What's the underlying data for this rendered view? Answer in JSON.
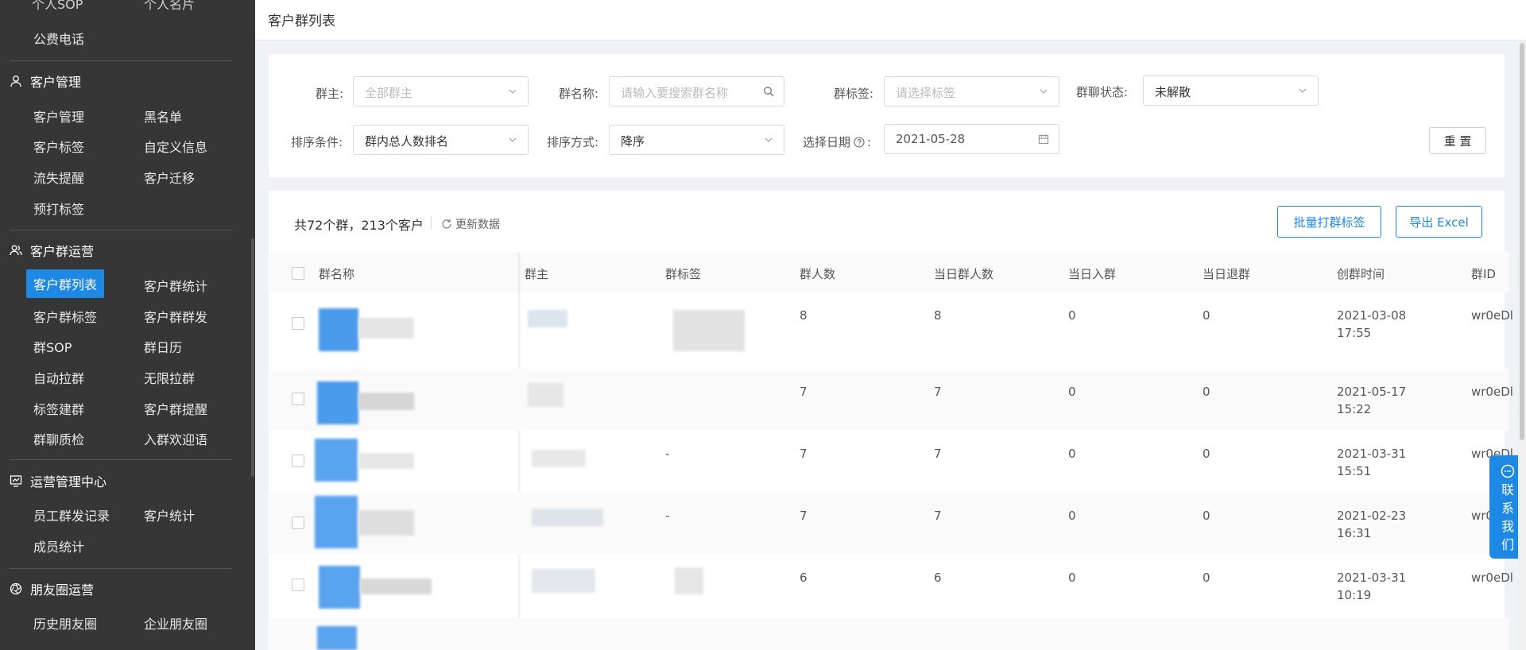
{
  "sidebar": {
    "clipped_top": [
      "个人SOP",
      "个人名片"
    ],
    "top_item": "公费电话",
    "sections": [
      {
        "title": "客户管理",
        "items": [
          "客户管理",
          "黑名单",
          "客户标签",
          "自定义信息",
          "流失提醒",
          "客户迁移",
          "预打标签"
        ]
      },
      {
        "title": "客户群运营",
        "items": [
          "客户群列表",
          "客户群统计",
          "客户群标签",
          "客户群群发",
          "群SOP",
          "群日历",
          "自动拉群",
          "无限拉群",
          "标签建群",
          "客户群提醒",
          "群聊质检",
          "入群欢迎语"
        ]
      },
      {
        "title": "运营管理中心",
        "items": [
          "员工群发记录",
          "客户统计",
          "成员统计"
        ]
      },
      {
        "title": "朋友圈运营",
        "items": [
          "历史朋友圈",
          "企业朋友圈"
        ]
      }
    ],
    "active_item": "客户群列表"
  },
  "header": {
    "title": "客户群列表"
  },
  "filters": {
    "owner": {
      "label": "群主:",
      "placeholder": "全部群主"
    },
    "name": {
      "label": "群名称:",
      "placeholder": "请输入要搜索群名称"
    },
    "tag": {
      "label": "群标签:",
      "placeholder": "请选择标签"
    },
    "status": {
      "label": "群聊状态:",
      "value": "未解散"
    },
    "sort_cond": {
      "label": "排序条件:",
      "value": "群内总人数排名"
    },
    "sort_order": {
      "label": "排序方式:",
      "value": "降序"
    },
    "date": {
      "label": "选择日期",
      "colon": ":",
      "value": "2021-05-28"
    },
    "reset_label": "重 置"
  },
  "summary": {
    "text": "共72个群，213个客户",
    "refresh_label": "更新数据"
  },
  "actions": {
    "bulk_tag": "批量打群标签",
    "export": "导出 Excel"
  },
  "table": {
    "columns": [
      "群名称",
      "群主",
      "群标签",
      "群人数",
      "当日群人数",
      "当日入群",
      "当日退群",
      "创群时间",
      "群ID"
    ],
    "rows": [
      {
        "tags": "",
        "members": "8",
        "today_members": "8",
        "joined": "0",
        "left": "0",
        "date": "2021-03-08",
        "time": "17:55",
        "id": "wr0eDl"
      },
      {
        "tags": "",
        "members": "7",
        "today_members": "7",
        "joined": "0",
        "left": "0",
        "date": "2021-05-17",
        "time": "15:22",
        "id": "wr0eDl"
      },
      {
        "tags": "-",
        "members": "7",
        "today_members": "7",
        "joined": "0",
        "left": "0",
        "date": "2021-03-31",
        "time": "15:51",
        "id": "wr0eDl"
      },
      {
        "tags": "-",
        "members": "7",
        "today_members": "7",
        "joined": "0",
        "left": "0",
        "date": "2021-02-23",
        "time": "16:31",
        "id": "wr0"
      },
      {
        "tags": "",
        "members": "6",
        "today_members": "6",
        "joined": "0",
        "left": "0",
        "date": "2021-03-31",
        "time": "10:19",
        "id": "wr0eDl"
      }
    ]
  },
  "float_contact": {
    "label_chars": [
      "联",
      "系",
      "我",
      "们"
    ]
  },
  "colors": {
    "sidebar_bg": "#363636",
    "accent": "#1e88e5",
    "page_bg": "#f0f2f5"
  }
}
